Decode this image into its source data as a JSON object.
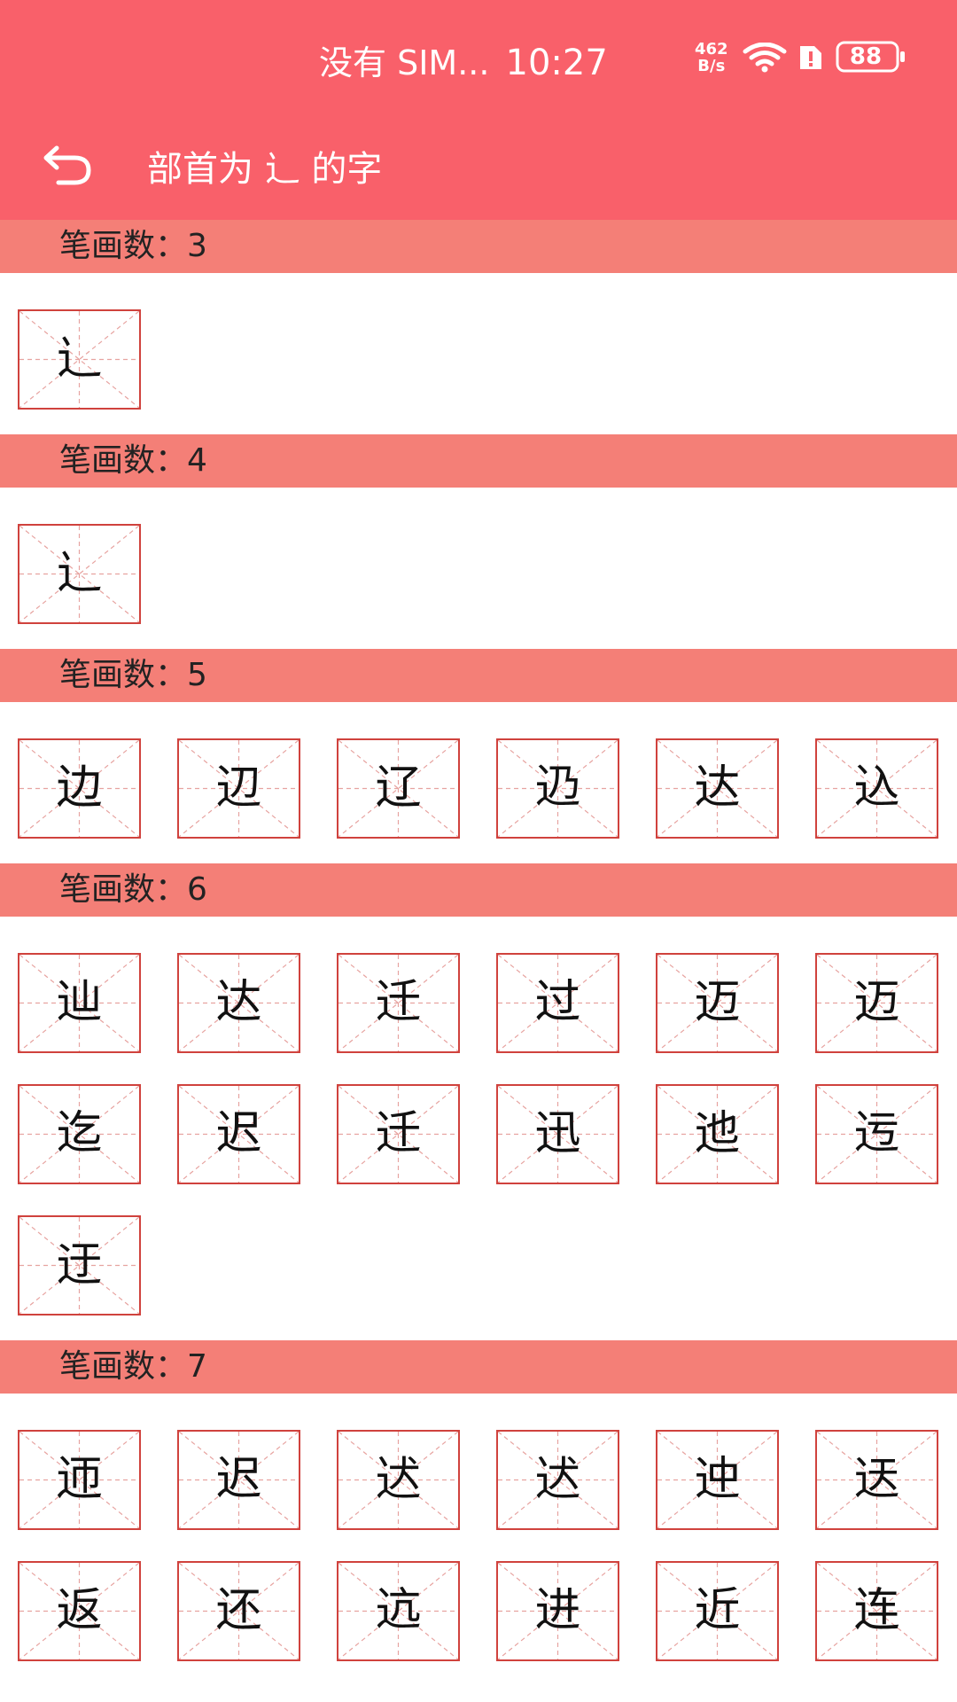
{
  "status_bar": {
    "carrier": "没有 SIM...",
    "time": "10:27",
    "net_speed_value": "462",
    "net_speed_unit": "B/s",
    "battery": "88"
  },
  "toolbar": {
    "title": "部首为 辶 的字"
  },
  "colors": {
    "accent": "#f9606a",
    "section_header": "#f47f77",
    "grid_border": "#d0423d"
  },
  "sections": [
    {
      "label": "笔画数：3",
      "chars": [
        "辶"
      ]
    },
    {
      "label": "笔画数：4",
      "chars": [
        "⻌"
      ]
    },
    {
      "label": "笔画数：5",
      "chars": [
        "边",
        "辺",
        "辽",
        "辸",
        "达",
        "込"
      ]
    },
    {
      "label": "笔画数：6",
      "chars": [
        "辿",
        "达",
        "迁",
        "过",
        "迈",
        "迈",
        "迄",
        "迟",
        "迁",
        "迅",
        "迆",
        "迃",
        "迂"
      ]
    },
    {
      "label": "笔画数：7",
      "chars": [
        "迊",
        "迟",
        "迖",
        "迖",
        "迚",
        "迗",
        "返",
        "还",
        "迒",
        "进",
        "近",
        "连"
      ]
    }
  ]
}
